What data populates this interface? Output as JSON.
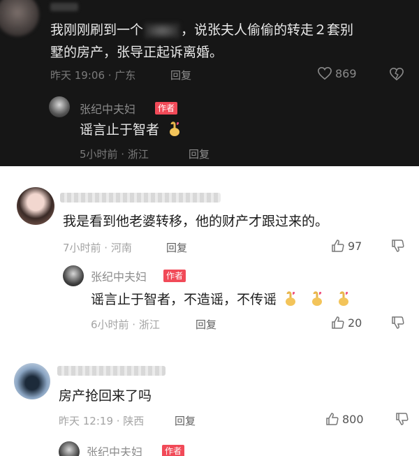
{
  "top_comment": {
    "text_line1": "我刚刚刷到一个",
    "text_line1_rest": "，说张夫人偷偷的转走２套别",
    "text_line2": "墅的房产，张导正起诉离婚。",
    "time_location": "昨天 19:06 · 广东",
    "reply_label": "回复",
    "like_count": "869",
    "reply": {
      "name": "张纪中夫妇",
      "badge": "作者",
      "text": "谣言止于智者",
      "time_location": "5小时前 · 浙江",
      "reply_label": "回复"
    }
  },
  "comment_two": {
    "text": "我是看到他老婆转移，他的财产才跟过来的。",
    "time_location": "7小时前 · 河南",
    "reply_label": "回复",
    "like_count": "97",
    "reply": {
      "name": "张纪中夫妇",
      "badge": "作者",
      "text": "谣言止于智者，不造谣，不传谣",
      "time_location": "6小时前 · 浙江",
      "reply_label": "回复",
      "like_count": "20"
    }
  },
  "comment_three": {
    "text": "房产抢回来了吗",
    "time_location": "昨天 12:19 · 陕西",
    "reply_label": "回复",
    "like_count": "800",
    "reply": {
      "name": "张纪中夫妇",
      "badge": "作者"
    }
  },
  "colors": {
    "dark_bg": "#161616",
    "author_badge": "#f14a58"
  }
}
